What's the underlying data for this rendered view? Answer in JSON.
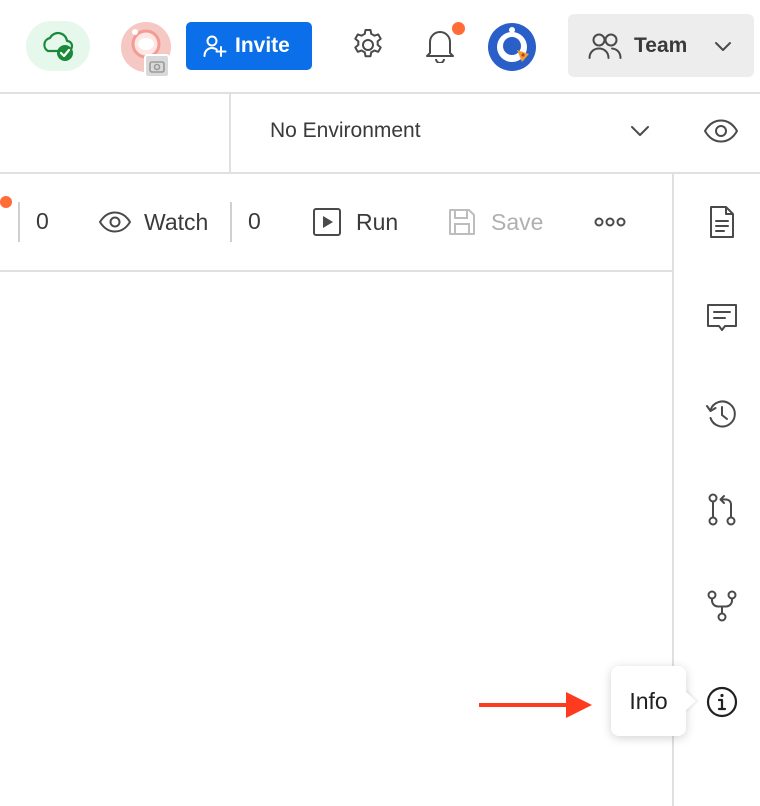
{
  "header": {
    "invite_label": "Invite",
    "team_label": "Team",
    "sync_status_icon": "cloud-check-icon",
    "notification_has_unread": true
  },
  "environment": {
    "selected": "No Environment"
  },
  "toolbar": {
    "count_left": "0",
    "watch_label": "Watch",
    "watch_count": "0",
    "run_label": "Run",
    "save_label": "Save",
    "more_icon": "ellipsis-icon"
  },
  "sidebar": {
    "items": [
      {
        "icon": "documentation-icon"
      },
      {
        "icon": "comments-icon"
      },
      {
        "icon": "history-icon"
      },
      {
        "icon": "pull-request-icon"
      },
      {
        "icon": "fork-icon"
      },
      {
        "icon": "info-icon"
      }
    ]
  },
  "tooltip": {
    "text": "Info"
  },
  "colors": {
    "invite_button": "#0a6fe8",
    "notification_dot": "#ff6c37",
    "sync_ok_bg": "#e6f7ec",
    "sync_ok_fg": "#1a8a3a",
    "annotation_arrow": "#ff3b1f"
  }
}
